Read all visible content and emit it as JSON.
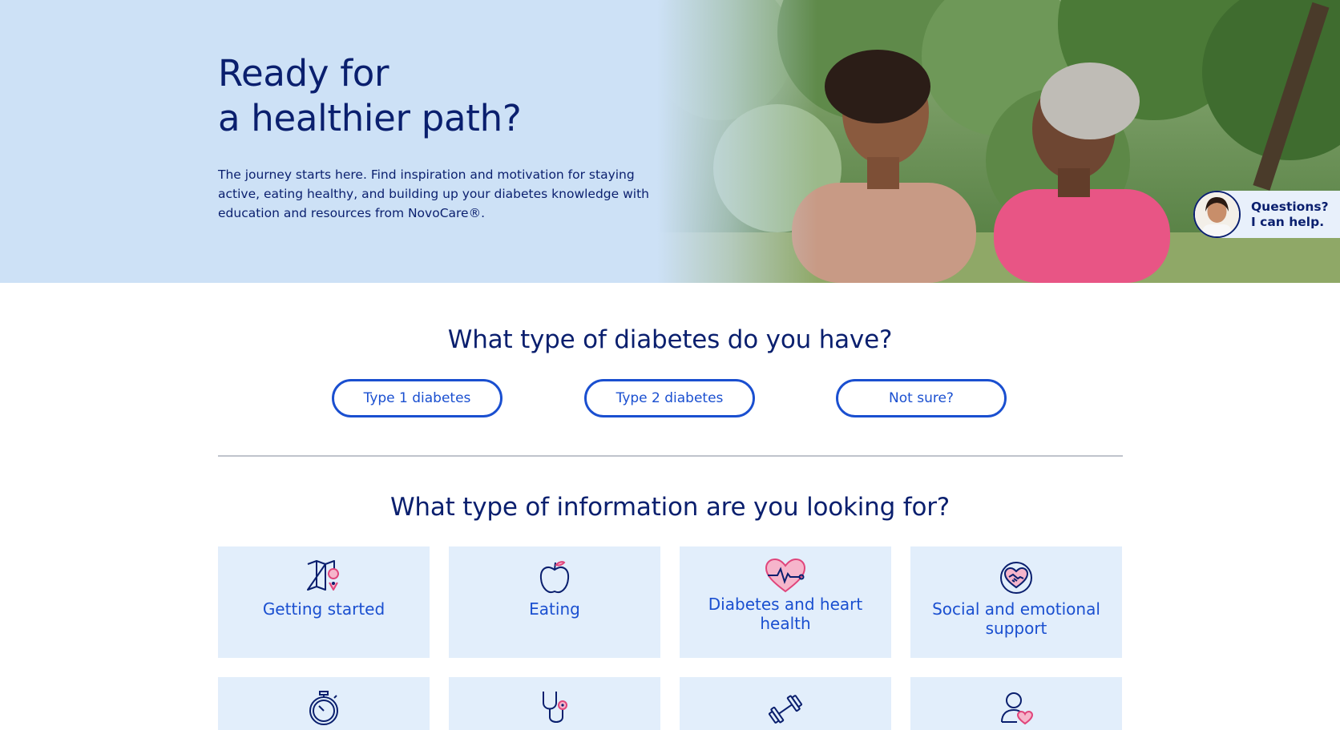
{
  "hero": {
    "title_line1": "Ready for",
    "title_line2": "a healthier path?",
    "body": "The journey starts here. Find inspiration and motivation for staying active, eating healthy, and building up your diabetes knowledge with education and resources from NovoCare®."
  },
  "chat": {
    "line1": "Questions?",
    "line2": "I can help."
  },
  "diabetes_type": {
    "heading": "What type of diabetes do you have?",
    "buttons": [
      "Type 1 diabetes",
      "Type 2 diabetes",
      "Not sure?"
    ]
  },
  "info_type": {
    "heading": "What type of information are you looking for?",
    "cards": [
      {
        "label": "Getting started",
        "icon": "map-pin-icon"
      },
      {
        "label": "Eating",
        "icon": "apple-icon"
      },
      {
        "label": "Diabetes and heart health",
        "icon": "heart-pulse-icon"
      },
      {
        "label": "Social and emotional support",
        "icon": "handshake-heart-icon"
      },
      {
        "label": "",
        "icon": "stopwatch-icon"
      },
      {
        "label": "",
        "icon": "stethoscope-icon"
      },
      {
        "label": "",
        "icon": "dumbbell-icon"
      },
      {
        "label": "",
        "icon": "person-heart-icon"
      }
    ]
  },
  "colors": {
    "hero_bg": "#cde1f6",
    "navy": "#0a1f6e",
    "accent_blue": "#1a4fd0",
    "card_bg": "#e2eefb",
    "pink": "#e0457b"
  }
}
